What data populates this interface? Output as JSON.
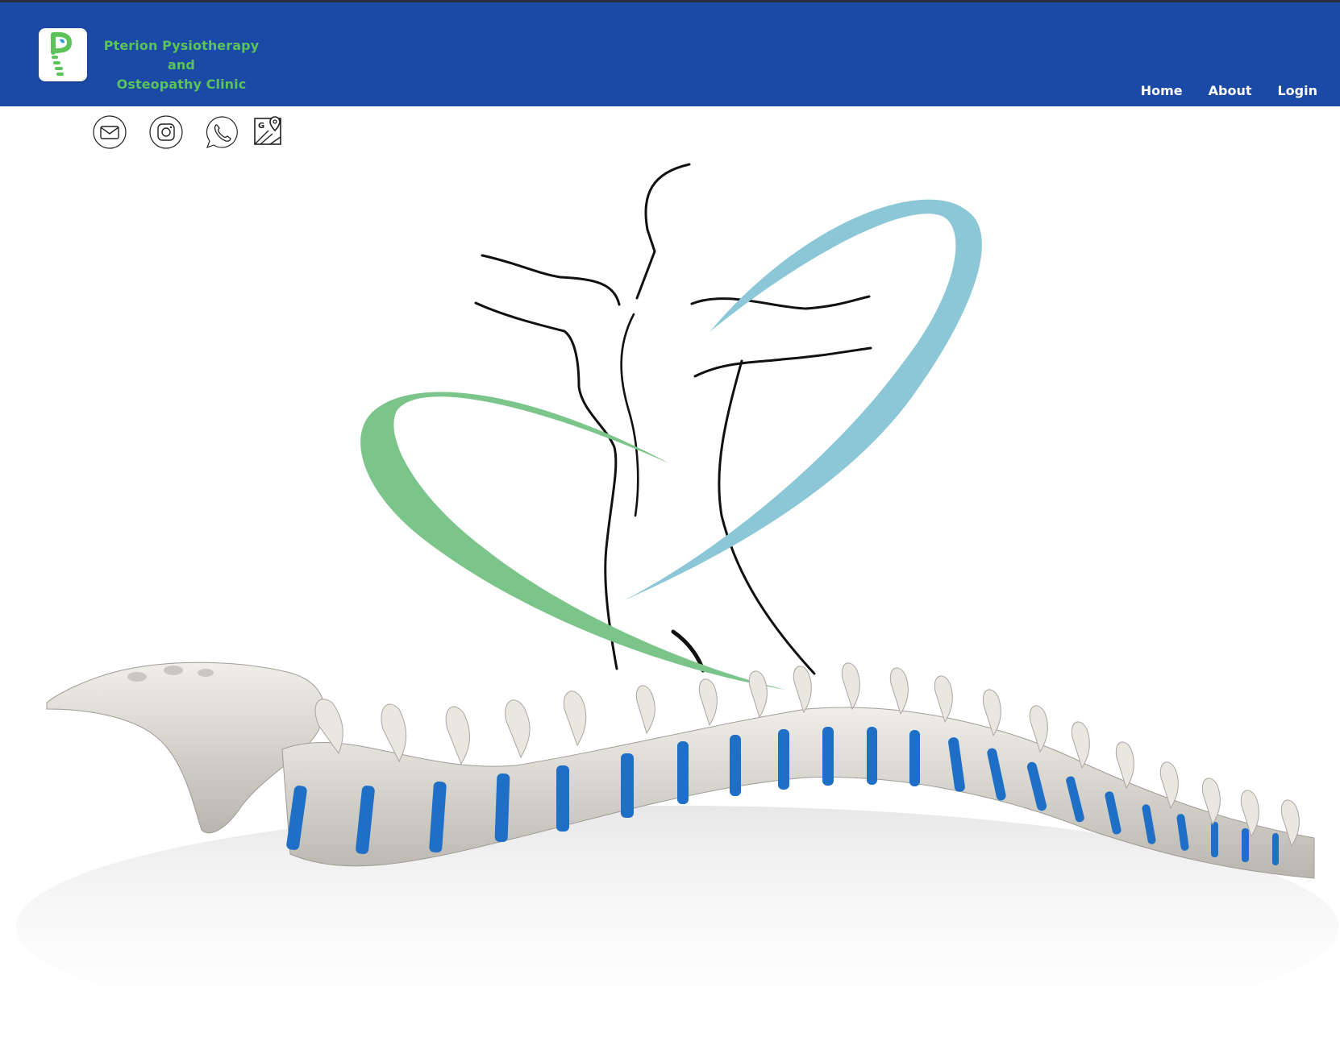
{
  "brand": {
    "name_line1": "Pterion Pysiotherapy and",
    "name_line2": "Osteopathy Clinic",
    "color": "#5cc35a"
  },
  "header": {
    "background": "#1b4aa6"
  },
  "nav": {
    "items": [
      {
        "label": "Home"
      },
      {
        "label": "About"
      },
      {
        "label": "Login"
      }
    ]
  },
  "social": {
    "items": [
      {
        "icon": "mail-icon"
      },
      {
        "icon": "instagram-icon"
      },
      {
        "icon": "whatsapp-icon"
      },
      {
        "icon": "google-maps-icon"
      }
    ]
  },
  "hero": {
    "figure_colors": {
      "green": "#7cc58a",
      "blue": "#8cc7d8",
      "outline": "#111111"
    },
    "spine_disc_color": "#1f6fc7"
  }
}
